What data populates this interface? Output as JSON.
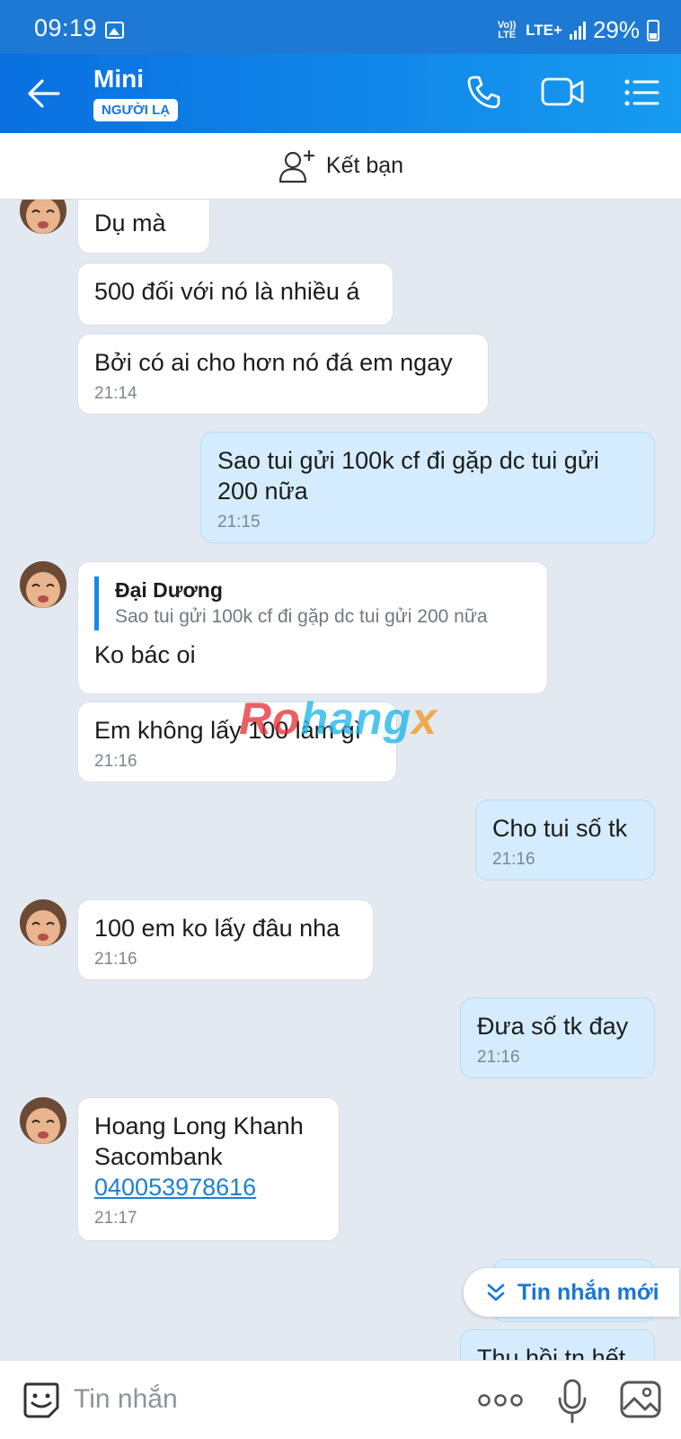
{
  "status_bar": {
    "time": "09:19",
    "volte": "Vo)) LTE",
    "network": "LTE+",
    "battery": "29%"
  },
  "header": {
    "name": "Mini",
    "badge": "NGƯỜI LẠ",
    "icons": [
      "back-arrow-icon",
      "phone-icon",
      "video-call-icon",
      "menu-list-icon"
    ]
  },
  "add_friend": {
    "label": "Kết bạn"
  },
  "messages": [
    {
      "from": "them",
      "text": "Dụ mà",
      "time": ""
    },
    {
      "from": "them",
      "text": "500 đối với nó là nhiều á",
      "time": ""
    },
    {
      "from": "them",
      "text": "Bởi có ai cho hơn nó đá em ngay",
      "time": "21:14"
    },
    {
      "from": "me",
      "text": "Sao tui gửi 100k cf đi gặp dc tui gửi 200 nữa",
      "time": "21:15"
    },
    {
      "from": "them",
      "reply_name": "Đại Dương",
      "reply_text": "Sao tui gửi 100k cf đi gặp dc tui gửi 200 nữa",
      "text": "Ko bác oi",
      "time": ""
    },
    {
      "from": "them",
      "text": "Em không lấy 100 làm gì",
      "time": "21:16"
    },
    {
      "from": "me",
      "text": "Cho tui số tk",
      "time": "21:16"
    },
    {
      "from": "them",
      "text": "100 em ko lấy đâu nha",
      "time": "21:16"
    },
    {
      "from": "me",
      "text": "Đưa số tk đay",
      "time": "21:16"
    },
    {
      "from": "them",
      "line1": "Hoang Long Khanh",
      "line2": "Sacombank",
      "link": "040053978616",
      "time": "21:17"
    },
    {
      "from": "me",
      "text": "Thu hồi tn hết",
      "time": ""
    }
  ],
  "watermark": {
    "part1": "Ro",
    "part2": "hang",
    "part3": "x"
  },
  "new_message_button": {
    "label": "Tin nhắn mới"
  },
  "input_bar": {
    "placeholder": "Tin nhắn"
  },
  "colors": {
    "header": "#1e79d5",
    "chat_bg": "#e2e9f1",
    "my_bubble": "#d4ecfd",
    "accent": "#1b76d3"
  }
}
